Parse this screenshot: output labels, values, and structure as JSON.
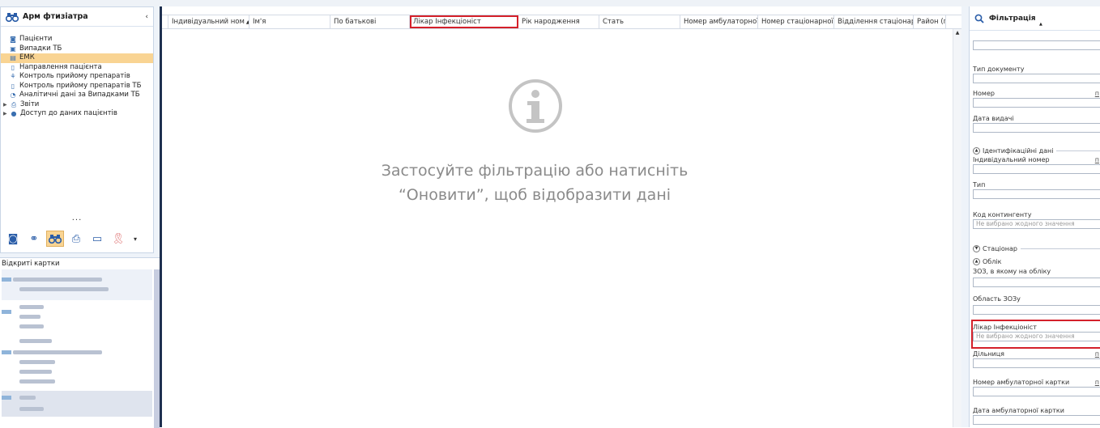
{
  "left_panel": {
    "title": "Арм фтизіатра",
    "collapse_glyph": "‹",
    "nav_items": [
      {
        "label": "Пацієнти",
        "icon": "patient-icon",
        "selected": false,
        "group": false
      },
      {
        "label": "Випадки ТБ",
        "icon": "cases-icon",
        "selected": false,
        "group": false
      },
      {
        "label": "ЕМК",
        "icon": "emk-icon",
        "selected": true,
        "group": false
      },
      {
        "label": "Направлення пацієнта",
        "icon": "document-icon",
        "selected": false,
        "group": false
      },
      {
        "label": "Контроль прийому препаратів",
        "icon": "pills-icon",
        "selected": false,
        "group": false
      },
      {
        "label": "Контроль прийому препаратів ТБ",
        "icon": "document-icon",
        "selected": false,
        "group": false
      },
      {
        "label": "Аналітичні дані за Випадками ТБ",
        "icon": "analytics-icon",
        "selected": false,
        "group": false
      },
      {
        "label": "Звіти",
        "icon": "reports-icon",
        "selected": false,
        "group": true
      },
      {
        "label": "Доступ до даних пацієнтів",
        "icon": "globe-icon",
        "selected": false,
        "group": true
      }
    ],
    "more_dots": "...",
    "recent_cards_title": "Відкриті картки"
  },
  "grid": {
    "columns": [
      {
        "label": "Індивідуальний ном",
        "sorted": true,
        "highlighted": false
      },
      {
        "label": "Ім'я",
        "sorted": false,
        "highlighted": false
      },
      {
        "label": "По батькові",
        "sorted": false,
        "highlighted": false
      },
      {
        "label": "Лікар Інфекціоніст",
        "sorted": false,
        "highlighted": true
      },
      {
        "label": "Рік народження",
        "sorted": false,
        "highlighted": false
      },
      {
        "label": "Стать",
        "sorted": false,
        "highlighted": false
      },
      {
        "label": "Номер амбулаторної к",
        "sorted": false,
        "highlighted": false
      },
      {
        "label": "Номер стаціонарної ка",
        "sorted": false,
        "highlighted": false
      },
      {
        "label": "Відділення стаціонару",
        "sorted": false,
        "highlighted": false
      },
      {
        "label": "Район (п",
        "sorted": false,
        "highlighted": false
      }
    ],
    "empty_message_line1": "Застосуйте фільтрацію або натисніть",
    "empty_message_line2": "“Оновити”, щоб відобразити дані"
  },
  "filter_panel": {
    "title": "Фільтрація",
    "fields": {
      "doc_type": {
        "label": "Тип документу"
      },
      "number": {
        "label": "Номер",
        "link": "п"
      },
      "issue_date": {
        "label": "Дата видачі"
      },
      "individual_number": {
        "label": "Індивідуальний номер",
        "link": "п"
      },
      "type": {
        "label": "Тип"
      },
      "contingent_code": {
        "label": "Код контингенту",
        "placeholder": "Не вибрано жодного значення"
      },
      "zoz": {
        "label": "ЗОЗ, в якому на обліку"
      },
      "zoz_region": {
        "label": "Область ЗОЗу"
      },
      "infectionist": {
        "label": "Лікар Інфекціоніст",
        "placeholder": "Не вибрано жодного значення"
      },
      "district": {
        "label": "Дільниця",
        "link": "п"
      },
      "ambulatory_card_number": {
        "label": "Номер амбулаторної картки",
        "link": "п"
      },
      "ambulatory_card_date": {
        "label": "Дата амбулаторної картки"
      }
    },
    "groups": {
      "identification": "Ідентифікаційні дані",
      "inpatient": "Стаціонар",
      "registration": "Облік"
    }
  }
}
